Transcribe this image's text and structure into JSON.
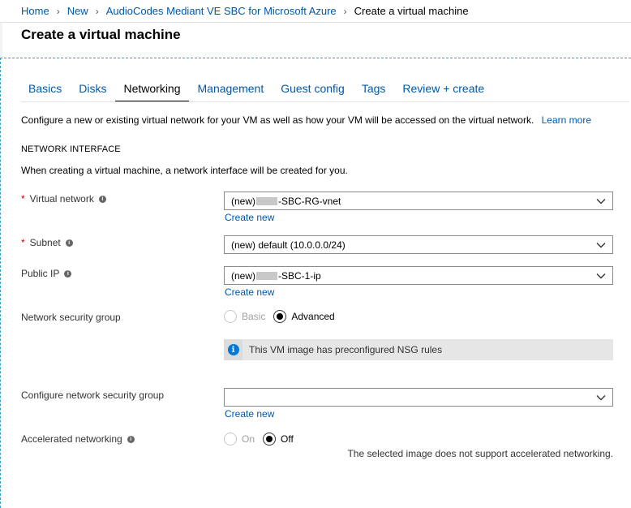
{
  "breadcrumb": {
    "items": [
      "Home",
      "New",
      "AudioCodes Mediant VE SBC for Microsoft Azure"
    ],
    "current": "Create a virtual machine"
  },
  "page_title": "Create a virtual machine",
  "tabs": [
    {
      "label": "Basics",
      "active": false
    },
    {
      "label": "Disks",
      "active": false
    },
    {
      "label": "Networking",
      "active": true
    },
    {
      "label": "Management",
      "active": false
    },
    {
      "label": "Guest config",
      "active": false
    },
    {
      "label": "Tags",
      "active": false
    },
    {
      "label": "Review + create",
      "active": false
    }
  ],
  "intro": {
    "text": "Configure a new or existing virtual network for your VM as well as how your VM will be accessed on the virtual network.",
    "learn_more": "Learn more"
  },
  "network_interface": {
    "heading": "NETWORK INTERFACE",
    "description": "When creating a virtual machine, a network interface will be created for you."
  },
  "fields": {
    "virtual_network": {
      "label": "Virtual network",
      "required_mark": "*",
      "value_prefix": "(new)",
      "value_suffix": "-SBC-RG-vnet",
      "create_new": "Create new"
    },
    "subnet": {
      "label": "Subnet",
      "required_mark": "*",
      "value": "(new) default (10.0.0.0/24)"
    },
    "public_ip": {
      "label": "Public IP",
      "value_prefix": "(new)",
      "value_suffix": "-SBC-1-ip",
      "create_new": "Create new"
    },
    "nsg": {
      "label": "Network security group",
      "options": [
        "Basic",
        "Advanced"
      ],
      "selected": "Advanced",
      "banner": "This VM image has preconfigured NSG rules"
    },
    "configure_nsg": {
      "label": "Configure network security group",
      "value": "",
      "create_new": "Create new"
    },
    "accelerated": {
      "label": "Accelerated networking",
      "options": [
        "On",
        "Off"
      ],
      "selected": "Off",
      "note": "The selected image does not support accelerated networking."
    }
  },
  "icons": {
    "info": "info-icon",
    "chevron": "chevron-down-icon"
  },
  "colors": {
    "link": "#0058ad",
    "required": "#c00000",
    "info_blue": "#0078d4",
    "dashed_border": "#3aa0c8"
  }
}
